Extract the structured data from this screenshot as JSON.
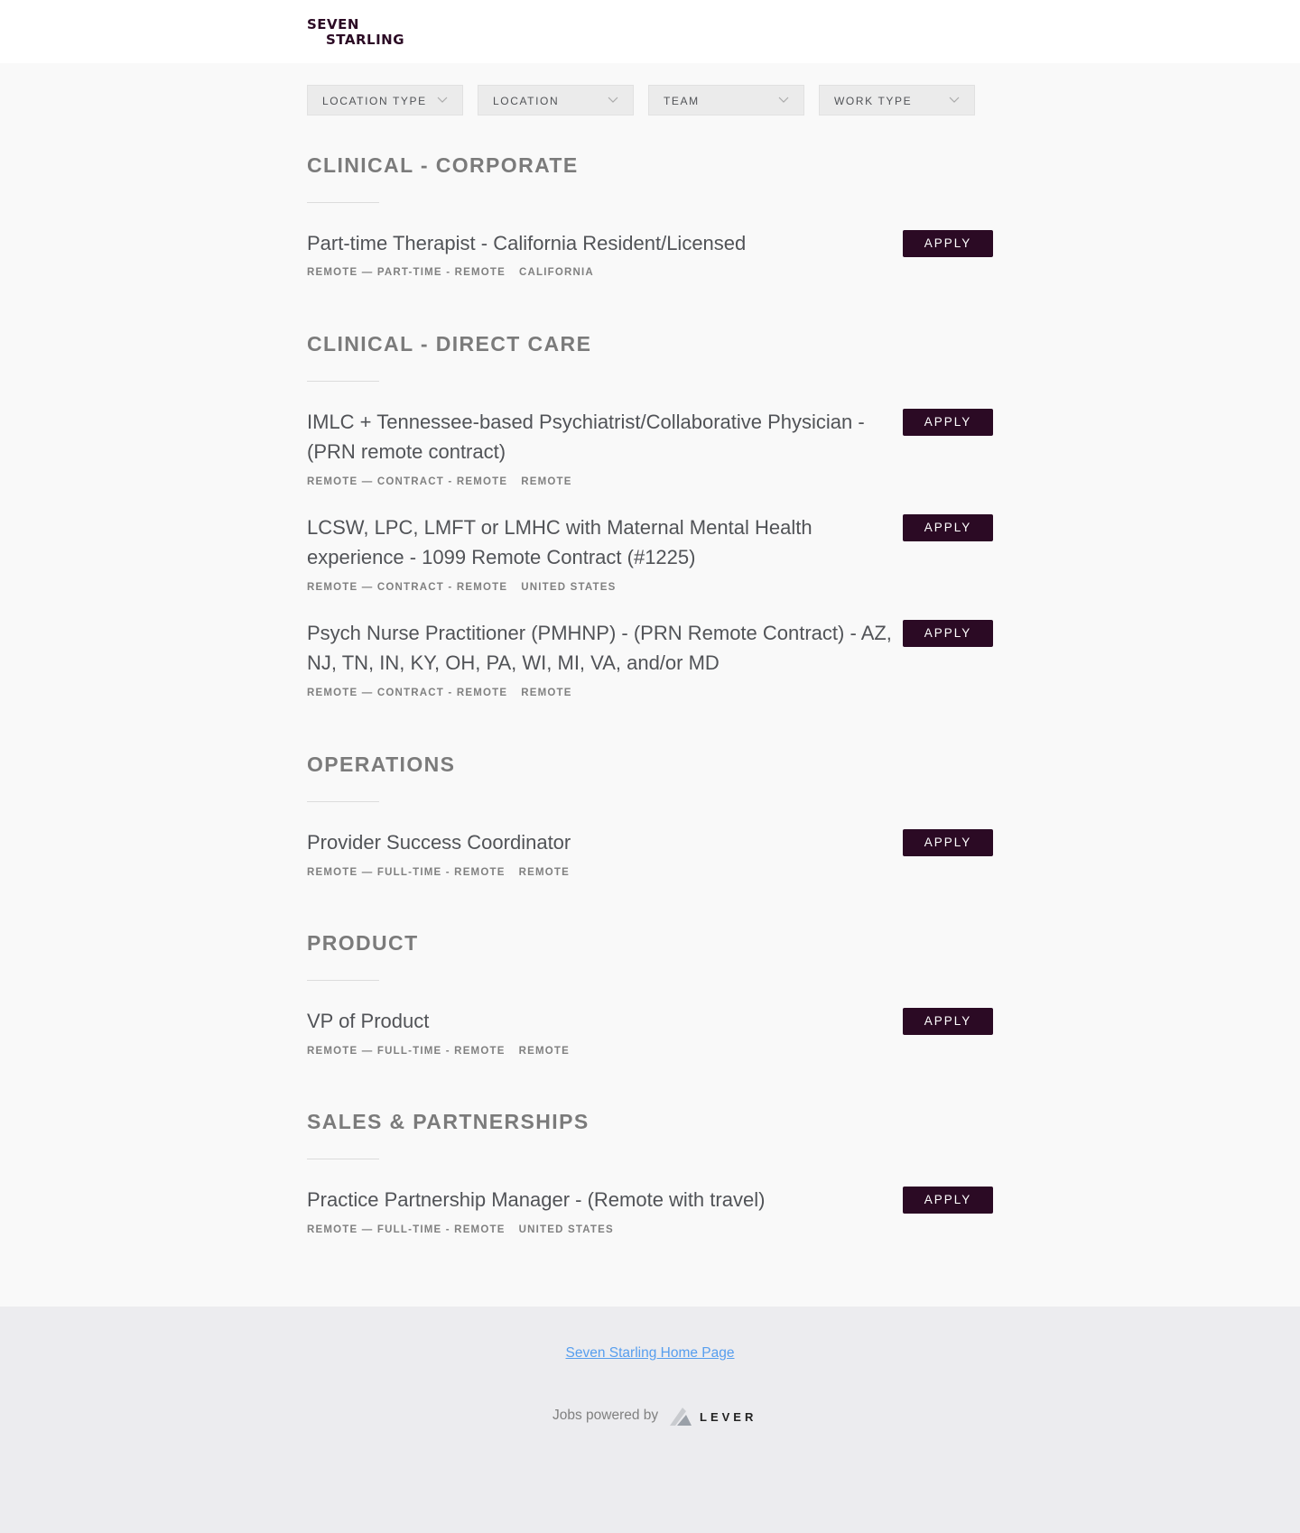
{
  "header": {
    "logo_line1": "SEVEN",
    "logo_line2": "STARLING"
  },
  "filters": [
    {
      "label": "LOCATION TYPE"
    },
    {
      "label": "LOCATION"
    },
    {
      "label": "TEAM"
    },
    {
      "label": "WORK TYPE"
    }
  ],
  "groups": [
    {
      "title": "CLINICAL - CORPORATE",
      "jobs": [
        {
          "title": "Part-time Therapist - California Resident/Licensed",
          "commitment": "REMOTE — PART-TIME - REMOTE",
          "location": "CALIFORNIA",
          "apply": "APPLY"
        }
      ]
    },
    {
      "title": "CLINICAL - DIRECT CARE",
      "jobs": [
        {
          "title": "IMLC + Tennessee-based Psychiatrist/Collaborative Physician - (PRN remote contract)",
          "commitment": "REMOTE — CONTRACT - REMOTE",
          "location": "REMOTE",
          "apply": "APPLY"
        },
        {
          "title": "LCSW, LPC, LMFT or LMHC with Maternal Mental Health experience - 1099 Remote Contract (#1225)",
          "commitment": "REMOTE — CONTRACT - REMOTE",
          "location": "UNITED STATES",
          "apply": "APPLY"
        },
        {
          "title": "Psych Nurse Practitioner (PMHNP) - (PRN Remote Contract) - AZ, NJ, TN, IN, KY, OH, PA, WI, MI, VA, and/or MD",
          "commitment": "REMOTE — CONTRACT - REMOTE",
          "location": "REMOTE",
          "apply": "APPLY"
        }
      ]
    },
    {
      "title": "OPERATIONS",
      "jobs": [
        {
          "title": "Provider Success Coordinator",
          "commitment": "REMOTE — FULL-TIME - REMOTE",
          "location": "REMOTE",
          "apply": "APPLY"
        }
      ]
    },
    {
      "title": "PRODUCT",
      "jobs": [
        {
          "title": "VP of Product",
          "commitment": "REMOTE — FULL-TIME - REMOTE",
          "location": "REMOTE",
          "apply": "APPLY"
        }
      ]
    },
    {
      "title": "SALES & PARTNERSHIPS",
      "jobs": [
        {
          "title": "Practice Partnership Manager - (Remote with travel)",
          "commitment": "REMOTE — FULL-TIME - REMOTE",
          "location": "UNITED STATES",
          "apply": "APPLY"
        }
      ]
    }
  ],
  "footer": {
    "home_link": "Seven Starling Home Page",
    "powered_by": "Jobs powered by",
    "lever": "LEVER"
  },
  "colors": {
    "brand": "#2b0a24",
    "link": "#579eee",
    "page_bg": "#f9f9f9",
    "footer_bg": "#ececef"
  }
}
